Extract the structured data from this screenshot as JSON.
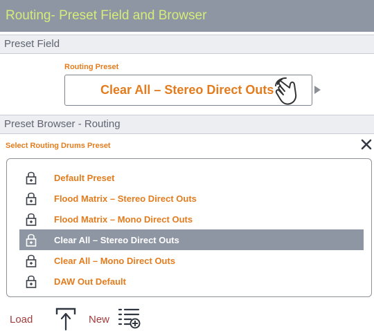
{
  "title_bar": {
    "title": "Routing- Preset Field and Browser"
  },
  "preset_field_section": {
    "header": "Preset Field",
    "label": "Routing Preset",
    "value": "Clear All – Stereo Direct Outs"
  },
  "browser_section": {
    "header": "Preset Browser - Routing",
    "label": "Select Routing Drums Preset",
    "close_icon": "close-icon",
    "items": [
      {
        "label": "Default Preset",
        "icon": "lock-icon",
        "selected": false
      },
      {
        "label": "Flood Matrix – Stereo Direct Outs",
        "icon": "lock-icon",
        "selected": false
      },
      {
        "label": "Flood Matrix – Mono Direct Outs",
        "icon": "lock-icon",
        "selected": false
      },
      {
        "label": "Clear All – Stereo Direct Outs",
        "icon": "lock-icon",
        "selected": true
      },
      {
        "label": "Clear All – Mono Direct Outs",
        "icon": "lock-icon",
        "selected": false
      },
      {
        "label": "DAW Out Default",
        "icon": "lock-icon",
        "selected": false
      }
    ]
  },
  "toolbar": {
    "load_label": "Load",
    "load_icon": "upload-arrow-icon",
    "new_label": "New",
    "new_icon": "add-list-icon"
  },
  "colors": {
    "title_bg": "#8e96a4",
    "title_text": "#d6ec7a",
    "accent_orange": "#e27c1e",
    "selected_bg": "#8e96a4",
    "toolbar_text": "#a13c3c",
    "section_bg": "#eceef2"
  }
}
